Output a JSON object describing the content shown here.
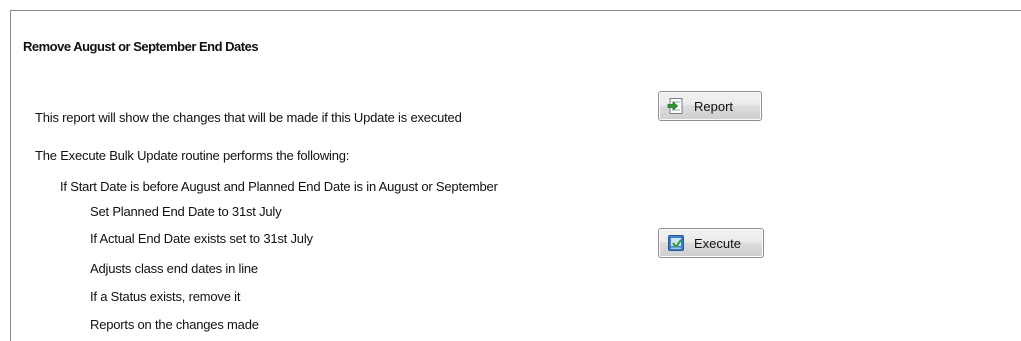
{
  "section": {
    "title": "Remove August or September End Dates"
  },
  "report": {
    "description": "This report will show the changes that will be made if this Update is executed",
    "button_label": "Report"
  },
  "execute": {
    "intro": "The Execute Bulk Update routine performs the following:",
    "condition": "If Start Date is before August and Planned End Date is in August or September",
    "steps": [
      "Set Planned End Date to 31st July",
      "If Actual End Date exists set to 31st July",
      "Adjusts class end dates in line",
      "If a Status exists, remove it",
      "Reports on the changes made"
    ],
    "button_label": "Execute"
  },
  "icons": {
    "report": "report-arrow-icon",
    "execute": "execute-icon"
  },
  "colors": {
    "panel_border": "#8a8a8a",
    "button_border": "#8e8f8f",
    "icon_green": "#2e9a3a",
    "icon_blue": "#3f7fc8"
  }
}
